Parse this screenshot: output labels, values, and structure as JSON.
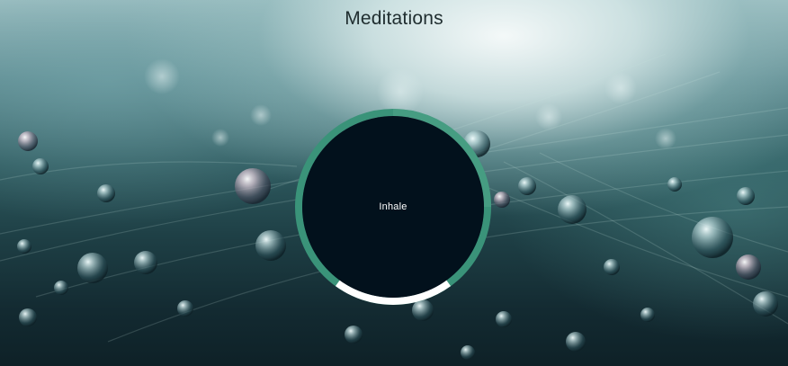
{
  "header": {
    "title": "Meditations"
  },
  "breathing": {
    "instruction": "Inhale",
    "colors": {
      "core": "#02111c",
      "ring_primary": "#3a9379",
      "ring_secondary": "#ffffff"
    }
  },
  "background": {
    "description_icon": "water-droplets-leaf-background"
  }
}
